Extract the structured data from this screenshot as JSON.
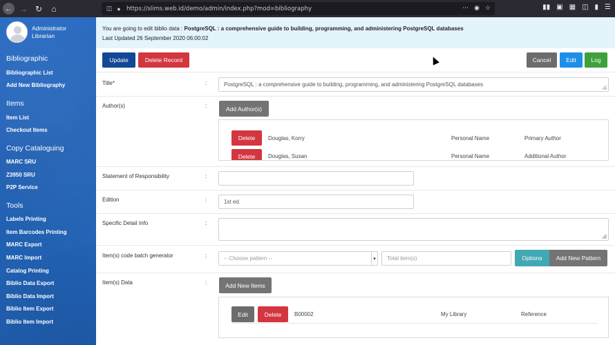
{
  "browser": {
    "url": "https://slims.web.id/demo/admin/index.php?mod=bibliography",
    "back_icon": "arrow-left-icon",
    "forward_icon": "arrow-right-icon",
    "reload_icon": "reload-icon",
    "home_icon": "home-icon"
  },
  "sidebar": {
    "user_name": "Administrator",
    "user_role": "Librarian",
    "sections": [
      {
        "heading": "Bibliographic",
        "items": [
          "Bibliographic List",
          "Add New Bibliography"
        ]
      },
      {
        "heading": "Items",
        "items": [
          "Item List",
          "Checkout Items"
        ]
      },
      {
        "heading": "Copy Cataloguing",
        "items": [
          "MARC SRU",
          "Z3950 SRU",
          "P2P Service"
        ]
      },
      {
        "heading": "Tools",
        "items": [
          "Labels Printing",
          "Item Barcodes Printing",
          "MARC Export",
          "MARC Import",
          "Catalog Printing",
          "Biblio Data Export",
          "Biblio Data Import",
          "Biblio Item Export",
          "Biblio Item Import"
        ]
      }
    ]
  },
  "notice": {
    "prefix": "You are going to edit biblio data : ",
    "title": "PostgreSQL : a comprehensive guide to building, programming, and administering PostgreSQL databases",
    "last_updated": "Last Updated 26 September 2020 06:00:02"
  },
  "toolbar": {
    "update": "Update",
    "delete_record": "Delete Record",
    "cancel": "Cancel",
    "edit": "Edit",
    "log": "Log"
  },
  "form": {
    "title_label": "Title*",
    "title_value": "PostgreSQL : a comprehensive guide to building, programming, and administering PostgreSQL databases",
    "authors_label": "Author(s)",
    "add_authors": "Add Author(s)",
    "authors": [
      {
        "name": "Douglas, Korry",
        "type": "Personal Name",
        "level": "Primary Author"
      },
      {
        "name": "Douglas, Susan",
        "type": "Personal Name",
        "level": "Additional Author"
      }
    ],
    "delete_label": "Delete",
    "responsibility_label": "Statement of Responsibility",
    "responsibility_value": "",
    "edition_label": "Edition",
    "edition_value": "1st ed.",
    "specific_label": "Specific Detail Info",
    "specific_value": "",
    "batch_label": "Item(s) code batch generator",
    "pattern_selected": "-- Choose pattern --",
    "total_placeholder": "Total item(s)",
    "options": "Options",
    "add_pattern": "Add New Pattern",
    "items_label": "Item(s) Data",
    "add_items": "Add New Items",
    "items": [
      {
        "code": "B00002",
        "location": "My Library",
        "collection": "Reference"
      }
    ],
    "edit_label": "Edit"
  },
  "colors": {
    "sidebar_blue": "#2367bd",
    "notice_bg": "#e4f4fb",
    "update_btn": "#124896",
    "delete_btn": "#d2363f",
    "edit_btn": "#1e8ee8",
    "log_btn": "#3ea13b"
  }
}
